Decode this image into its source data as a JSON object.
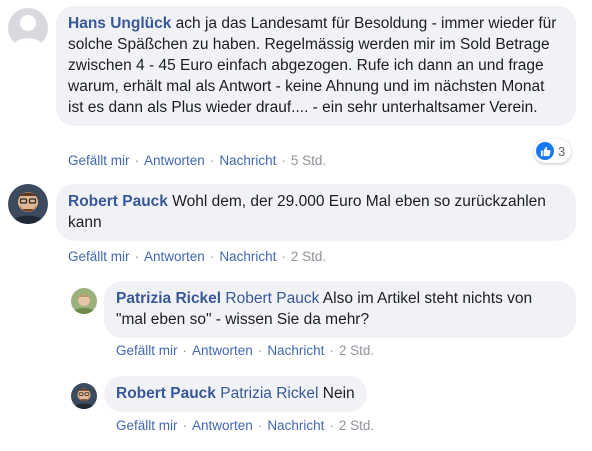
{
  "comments": [
    {
      "author": "Hans Unglück",
      "text": "ach ja das Landesamt für Besoldung - immer wieder für solche Späßchen zu haben. Regelmässig werden mir im Sold Betrage zwischen 4 - 45 Euro einfach abgezogen. Rufe ich dann an und frage warum, erhält mal als Antwort - keine Ahnung und im nächsten Monat ist es dann als Plus wieder drauf.... - ein sehr unterhaltsamer Verein.",
      "actions": {
        "like": "Gefällt mir",
        "reply": "Antworten",
        "message": "Nachricht",
        "time": "5 Std."
      },
      "reactions": {
        "icon": "like-icon",
        "count": "3"
      },
      "avatar": "default-profile-avatar"
    },
    {
      "author": "Robert Pauck",
      "text": "Wohl dem, der 29.000 Euro Mal eben so zurückzahlen kann",
      "actions": {
        "like": "Gefällt mir",
        "reply": "Antworten",
        "message": "Nachricht",
        "time": "2 Std."
      },
      "avatar": "robert-pauck-avatar"
    },
    {
      "author": "Patrizia Rickel",
      "mention": "Robert Pauck",
      "text": "Also im Artikel steht nichts von \"mal eben so\" - wissen Sie da mehr?",
      "actions": {
        "like": "Gefällt mir",
        "reply": "Antworten",
        "message": "Nachricht",
        "time": "2 Std."
      },
      "avatar": "patrizia-rickel-avatar"
    },
    {
      "author": "Robert Pauck",
      "mention": "Patrizia Rickel",
      "text": "Nein",
      "actions": {
        "like": "Gefällt mir",
        "reply": "Antworten",
        "message": "Nachricht",
        "time": "2 Std."
      },
      "avatar": "robert-pauck-avatar"
    }
  ],
  "separator": "·",
  "colors": {
    "name": "#385898",
    "bubble": "#f0f2f5",
    "meta": "#606770",
    "like": "#1877f2"
  }
}
